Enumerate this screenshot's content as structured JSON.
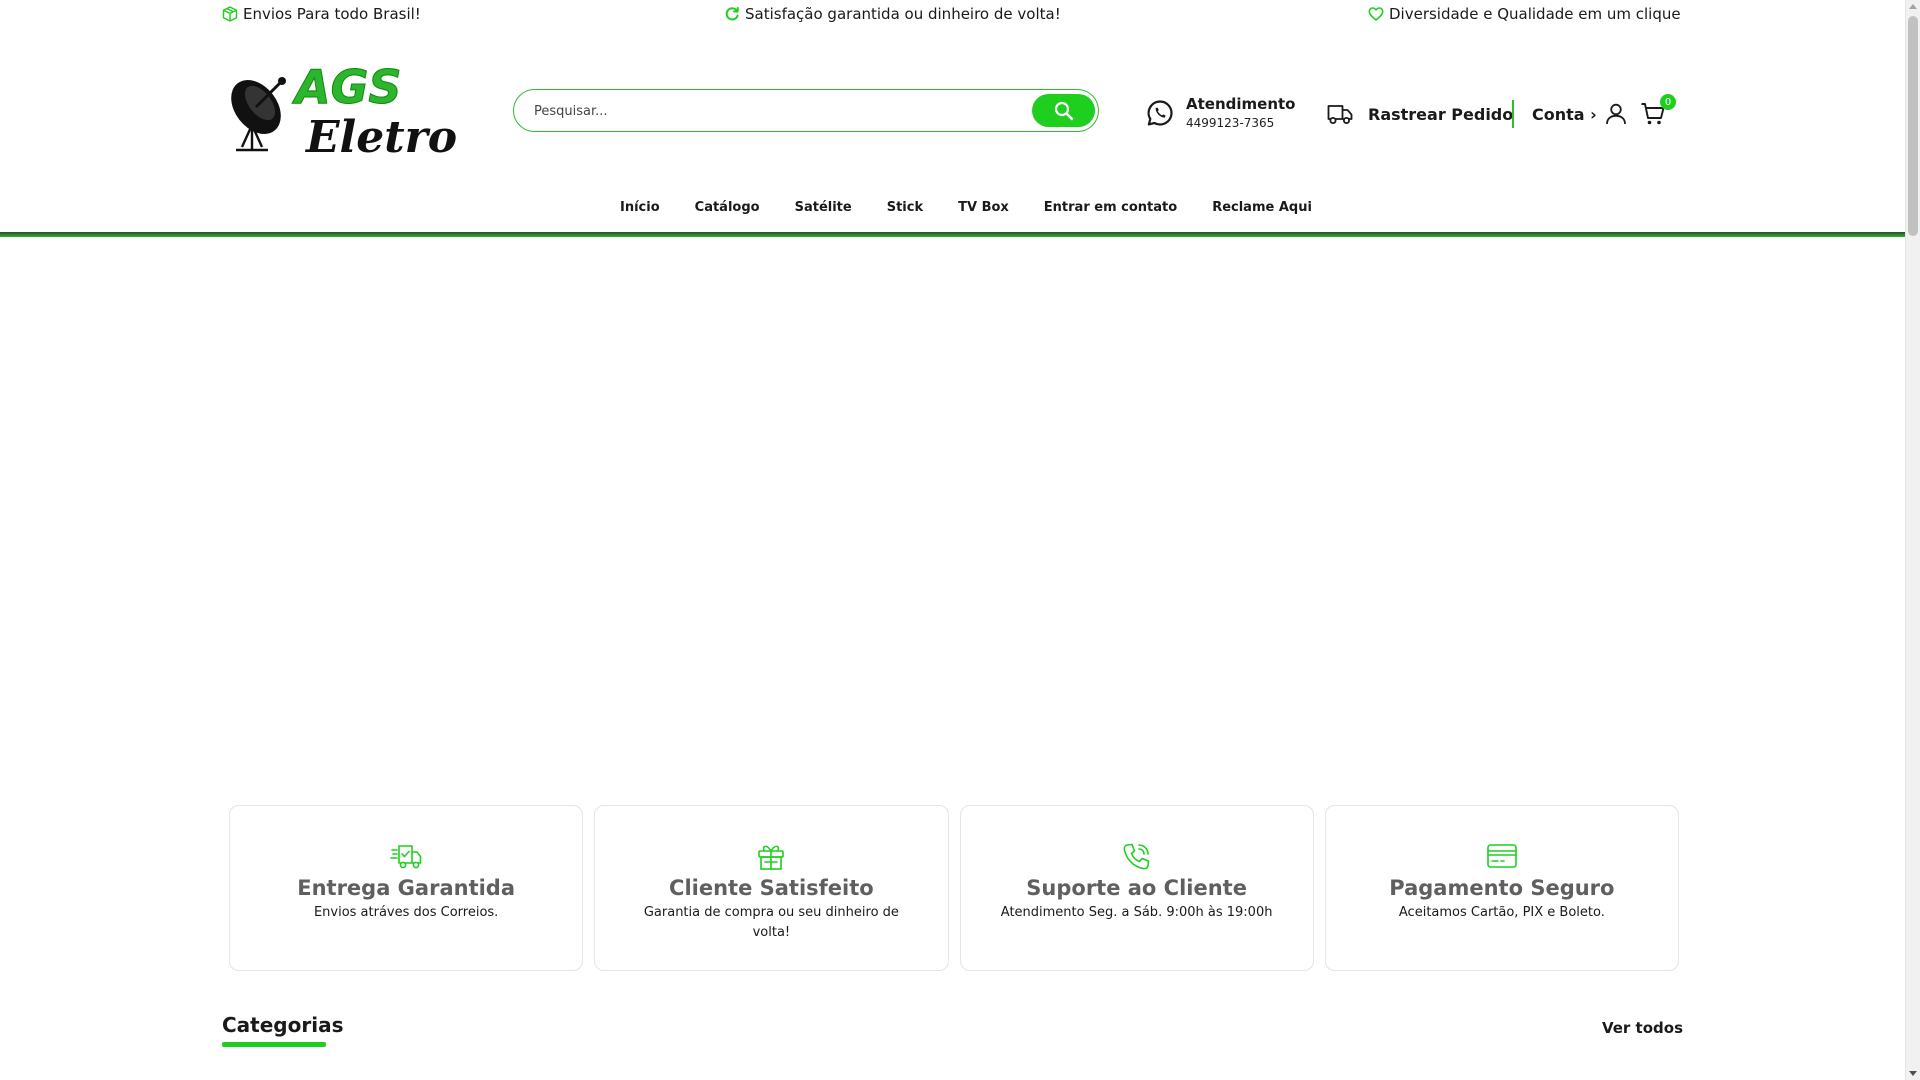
{
  "topbar": {
    "shipping": "Envios Para todo Brasil!",
    "guarantee": "Satisfação garantida ou dinheiro de volta!",
    "diversity": "Diversidade e Qualidade em um clique"
  },
  "header": {
    "logo_text_top": "AGS",
    "logo_text_bottom": "Eletro",
    "search_placeholder": "Pesquisar...",
    "support_title": "Atendimento",
    "support_phone": "4499123-7365",
    "track_label": "Rastrear Pedido",
    "account_label": "Conta ›",
    "cart_count": "0"
  },
  "nav": {
    "items": [
      "Início",
      "Catálogo",
      "Satélite",
      "Stick",
      "TV Box",
      "Entrar em contato",
      "Reclame Aqui"
    ]
  },
  "features": [
    {
      "title": "Entrega Garantida",
      "desc": "Envios atráves dos Correios."
    },
    {
      "title": "Cliente Satisfeito",
      "desc": "Garantia de compra ou seu dinheiro de volta!"
    },
    {
      "title": "Suporte ao Cliente",
      "desc": "Atendimento Seg. a Sáb. 9:00h às 19:00h"
    },
    {
      "title": "Pagamento Seguro",
      "desc": "Aceitamos Cartão, PIX e Boleto."
    }
  ],
  "categories": {
    "heading": "Categorias",
    "view_all": "Ver todos"
  },
  "colors": {
    "accent": "#1fcf1f",
    "nav_bar_dark": "#2b4a2b"
  }
}
